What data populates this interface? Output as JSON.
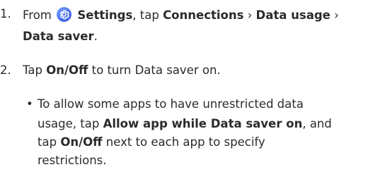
{
  "step1": {
    "number": "1.",
    "from": "From",
    "settings_icon": "settings-gear-icon",
    "settings": "Settings",
    "tap": ", tap",
    "connections": "Connections",
    "sep1": "›",
    "data_usage": "Data usage",
    "sep2": "›",
    "data_saver": "Data saver",
    "period": "."
  },
  "step2": {
    "number": "2.",
    "tap": "Tap",
    "onoff": "On/Off",
    "rest": "to turn Data saver on."
  },
  "bullet": {
    "symbol": "•",
    "line1": "To allow some apps to have unrestricted data",
    "line2_pre": "usage, tap",
    "allow_app": "Allow app while Data saver on",
    "line2_post": ", and",
    "line3_pre": "tap",
    "onoff": "On/Off",
    "line3_post": "next to each app to specify",
    "line4": "restrictions."
  },
  "colors": {
    "text": "#2b2b2b",
    "icon": "#4a6fee"
  }
}
